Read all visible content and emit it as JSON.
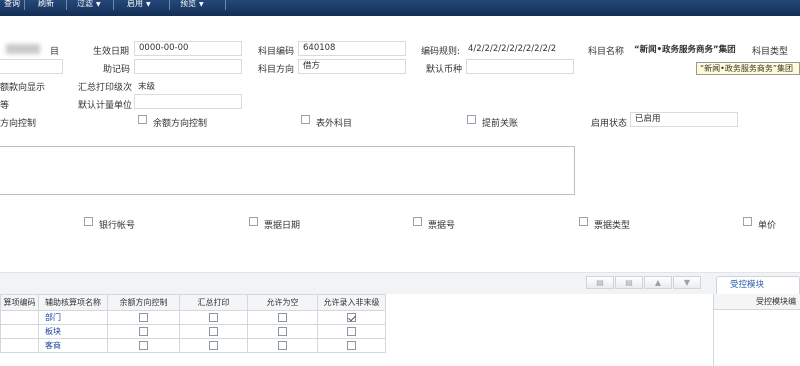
{
  "toolbar": {
    "items": [
      "查询",
      "刷新",
      "过滤",
      "启用",
      "预览"
    ]
  },
  "form": {
    "row1": {
      "effective_date_label": "生效日期",
      "effective_date_value": "0000-00-00",
      "subject_code_label": "科目编码",
      "subject_code_value": "640108",
      "code_rule_label": "编码规则:",
      "code_rule_value": "4/2/2/2/2/2/2/2/2/2/2",
      "subject_name_label": "科目名称",
      "subject_name_value": "“新闻•政务服务商务”集团",
      "subject_type_label": "科目类型"
    },
    "row2": {
      "mnemonic_label": "助记码",
      "direction_label": "科目方向",
      "direction_value": "借方",
      "default_currency_label": "默认币种",
      "tooltip": "“新闻•政务服务商务”集团"
    },
    "row3": {
      "balance_display_label": "额款向显示",
      "summary_level_label": "汇总打印级次",
      "summary_level_value": "末级"
    },
    "row4": {
      "left_cut_label": "等",
      "default_unit_label": "默认计量单位"
    },
    "row5": {
      "direction_control_label": "方向控制",
      "balance_control_label": "余额方向控制",
      "off_balance_label": "表外科目",
      "closing_label": "提前关账",
      "status_label": "启用状态",
      "status_value": "已启用"
    },
    "row6": {
      "bank_account_label": "银行帐号",
      "bill_date_label": "票据日期",
      "bill_no_label": "票据号",
      "bill_type_label": "票据类型",
      "unit_price_label": "单价"
    },
    "label_fragment": "目"
  },
  "icon_buttons": [
    "print-icon",
    "export-icon",
    "move-up-icon",
    "move-down-icon"
  ],
  "tabs": {
    "active": "受控模块"
  },
  "grid": {
    "columns": [
      "算项编码",
      "辅助核算项名称",
      "余额方向控制",
      "汇总打印",
      "允许为空",
      "允许录入非末级"
    ],
    "rows": [
      {
        "name": "部门",
        "balance": false,
        "summary": false,
        "allow_empty": false,
        "non_leaf": true
      },
      {
        "name": "板块",
        "balance": false,
        "summary": false,
        "allow_empty": false,
        "non_leaf": false
      },
      {
        "name": "客商",
        "balance": false,
        "summary": false,
        "allow_empty": false,
        "non_leaf": false
      }
    ]
  },
  "right_grid": {
    "header": "受控模块编"
  }
}
